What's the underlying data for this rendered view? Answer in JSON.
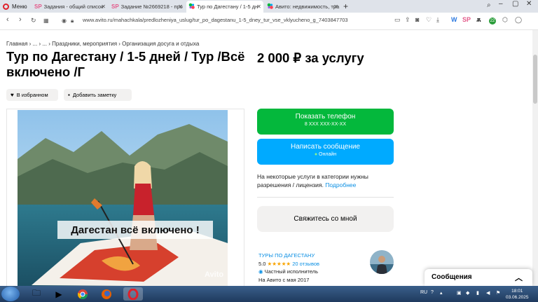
{
  "browser": {
    "menu_label": "Меню",
    "tabs": [
      {
        "favicon": "SP",
        "label": "Задания - общий список"
      },
      {
        "favicon": "SP",
        "label": "Задание №2669218 - про"
      },
      {
        "favicon": "avito",
        "label": "Тур по Дагестану / 1-5 дн"
      },
      {
        "favicon": "avito",
        "label": "Авито: недвижимость, тра"
      }
    ],
    "url_domain": "www.avito.ru",
    "url_path": "/mahachkala/predlozheniya_uslug/tur_po_dagestanu_1-5_dney_tur_vse_vklyucheno_g_7403847703",
    "extension_badge": "22"
  },
  "page": {
    "breadcrumb": [
      "Главная",
      "...",
      "...",
      "Праздники, мероприятия",
      "Организация досуга и отдыха"
    ],
    "title": "Тур по Дагестану / 1-5 дней / Тур /Всё включено /Г",
    "price": "2 000 ₽ за услугу",
    "favorite_label": "В избранном",
    "note_label": "Добавить заметку",
    "photo_caption": "Дагестан всё включено !",
    "watermark": "Avito",
    "show_phone": {
      "label": "Показать телефон",
      "sub": "8 XXX XXX-XX-XX",
      "color": "#04b83c"
    },
    "write_message": {
      "label": "Написать сообщение",
      "sub": "Онлайн",
      "color": "#00aaff"
    },
    "license_note": "На некоторые услуги в категории нужны разрешения / лицензия.",
    "license_link": "Подробнее",
    "contact_me": "Свяжитесь со мной",
    "seller": {
      "name": "Туры по Дагестану",
      "rating": "5.0",
      "stars": "★★★★★",
      "reviews": "20 отзывов",
      "type": "Частный исполнитель",
      "since": "На Авито с мая 2017"
    },
    "messages_panel": "Сообщения"
  },
  "taskbar": {
    "lang": "RU",
    "time": "18:01",
    "date": "03.06.2025"
  }
}
